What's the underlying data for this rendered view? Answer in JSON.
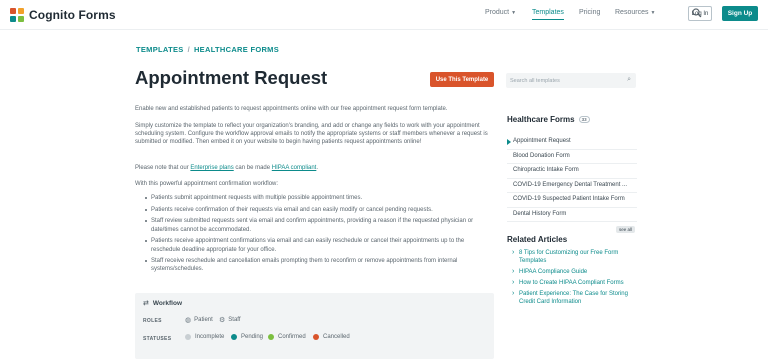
{
  "header": {
    "brand": "Cognito Forms",
    "nav": [
      {
        "label": "Product",
        "has_menu": true
      },
      {
        "label": "Templates",
        "has_menu": false,
        "active": true
      },
      {
        "label": "Pricing",
        "has_menu": false
      },
      {
        "label": "Resources",
        "has_menu": true
      }
    ],
    "search_icon": "search-icon",
    "login_label": "Log In",
    "signup_label": "Sign Up"
  },
  "breadcrumb": {
    "root": "TEMPLATES",
    "separator": "/",
    "current": "HEALTHCARE FORMS"
  },
  "page_title": "Appointment Request",
  "use_template_label": "Use This Template",
  "intro": "Enable new and established patients to request appointments online with our free appointment request form template.",
  "customize": "Simply customize the template to reflect your organization's branding, and add or change any fields to work with your appointment scheduling system. Configure the workflow approval emails to notify the appropriate systems or staff members whenever a request is submitted or modified. Then embed it on your website to begin having patients request appointments online!",
  "note": {
    "before": "Please note that our ",
    "link1": "Enterprise plans",
    "middle": " can be made ",
    "link2": "HIPAA compliant",
    "after": "."
  },
  "powerful": "With this powerful appointment confirmation workflow:",
  "bullets": [
    "Patients submit appointment requests with multiple possible appointment times.",
    "Patients receive confirmation of their requests via email and can easily modify or cancel pending requests.",
    "Staff review submitted requests sent via email and confirm appointments, providing a reason if the requested physician or date/times cannot be accommodated.",
    "Patients receive appointment confirmations via email and can easily reschedule or cancel their appointments up to the reschedule deadline appropriate for your office.",
    "Staff receive reschedule and cancellation emails prompting them to reconfirm or remove appointments from internal systems/schedules."
  ],
  "workflow": {
    "title": "Workflow",
    "roles_label": "ROLES",
    "roles": [
      "Patient",
      "Staff"
    ],
    "statuses_label": "STATUSES",
    "statuses": [
      {
        "label": "Incomplete",
        "color": "#c9cfd3"
      },
      {
        "label": "Pending",
        "color": "#0c8b8b"
      },
      {
        "label": "Confirmed",
        "color": "#7cbf3f"
      },
      {
        "label": "Cancelled",
        "color": "#d9542b"
      }
    ]
  },
  "sidebar": {
    "search_placeholder": "Search all templates",
    "category_title": "Healthcare Forms",
    "category_count": "33",
    "templates": [
      "Appointment Request",
      "Blood Donation Form",
      "Chiropractic Intake Form",
      "COVID-19 Emergency Dental Treatment ...",
      "COVID-19 Suspected Patient Intake Form",
      "Dental History Form"
    ],
    "see_all_label": "see all",
    "articles_title": "Related Articles",
    "articles": [
      "8 Tips for Customizing our Free Form Templates",
      "HIPAA Compliance Guide",
      "How to Create HIPAA Compliant Forms",
      "Patient Experience: The Case for Storing Credit Card Information"
    ]
  },
  "colors": {
    "accent": "#0c8b8b",
    "cta": "#d9542b"
  }
}
